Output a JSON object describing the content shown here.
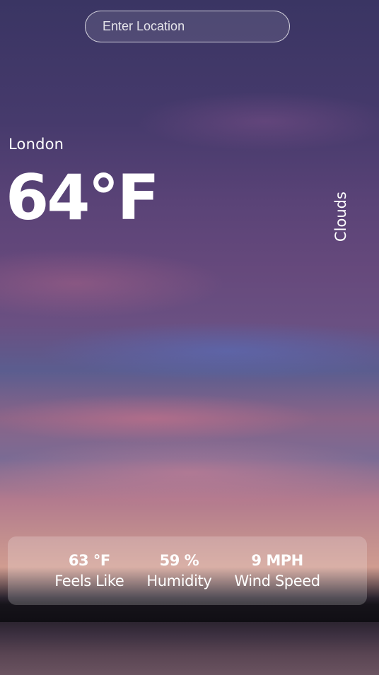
{
  "search": {
    "placeholder": "Enter Location",
    "value": ""
  },
  "weather": {
    "city": "London",
    "temperature": "64°F",
    "condition": "Clouds"
  },
  "stats": [
    {
      "value": "63 °F",
      "label": "Feels Like"
    },
    {
      "value": "59 %",
      "label": "Humidity"
    },
    {
      "value": "9 MPH",
      "label": "Wind Speed"
    }
  ]
}
